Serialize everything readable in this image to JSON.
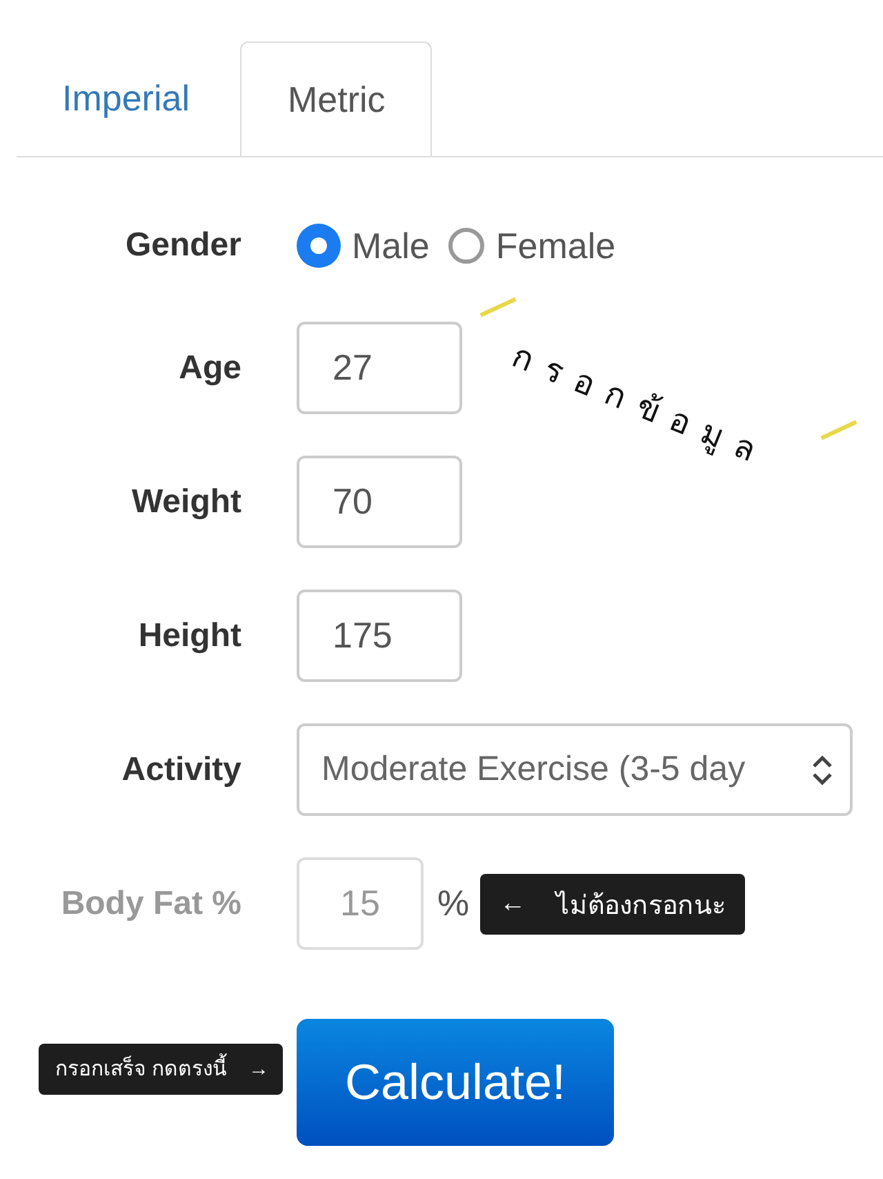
{
  "tabs": [
    {
      "label": "Imperial",
      "selected": false
    },
    {
      "label": "Metric",
      "selected": true
    }
  ],
  "form": {
    "rows": [
      {
        "kind": "radio",
        "label": "Gender",
        "disabled": false,
        "options": [
          {
            "label": "Male",
            "selected": true
          },
          {
            "label": "Female",
            "selected": false
          }
        ]
      },
      {
        "kind": "text",
        "label": "Age",
        "value": "27",
        "disabled": false
      },
      {
        "kind": "text",
        "label": "Weight",
        "value": "70",
        "disabled": false
      },
      {
        "kind": "text",
        "label": "Height",
        "value": "175",
        "disabled": false
      },
      {
        "kind": "select",
        "label": "Activity",
        "value": "Moderate Exercise (3-5 day",
        "disabled": false
      },
      {
        "kind": "text",
        "label": "Body Fat %",
        "value": "15",
        "disabled": true,
        "unit": "%",
        "note": {
          "arrow": "←",
          "text": "ไม่ต้องกรอกนะ"
        }
      }
    ],
    "submit": {
      "label": "Calculate!",
      "note": {
        "text": "กรอกเสร็จ กดตรงนี้",
        "arrow": "→"
      }
    }
  },
  "annotation": {
    "text": "กรอกข้อมูล"
  }
}
